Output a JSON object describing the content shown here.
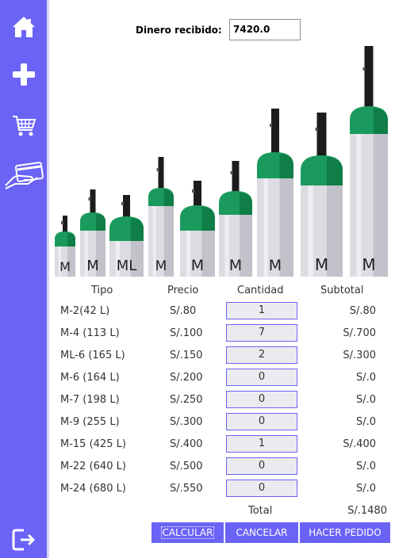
{
  "sidebar": {
    "items": [
      {
        "icon": "home-icon"
      },
      {
        "icon": "plus-icon"
      },
      {
        "icon": "cart-icon"
      },
      {
        "icon": "payment-card-icon"
      }
    ],
    "logout_icon": "logout-icon"
  },
  "received": {
    "label": "Dinero recibido:",
    "value": "7420.0"
  },
  "cylinders": [
    {
      "letter": "M"
    },
    {
      "letter": "M"
    },
    {
      "letter": "ML"
    },
    {
      "letter": "M"
    },
    {
      "letter": "M"
    },
    {
      "letter": "M"
    },
    {
      "letter": "M"
    },
    {
      "letter": "M"
    },
    {
      "letter": "M"
    }
  ],
  "table": {
    "headers": [
      "Tipo",
      "Precio",
      "Cantidad",
      "Subtotal"
    ],
    "rows": [
      {
        "tipo": "M-2(42 L)",
        "precio": "S/.80",
        "cantidad": "1",
        "subtotal": "S/.80"
      },
      {
        "tipo": "M-4 (113 L)",
        "precio": "S/.100",
        "cantidad": "7",
        "subtotal": "S/.700"
      },
      {
        "tipo": "ML-6 (165 L)",
        "precio": "S/.150",
        "cantidad": "2",
        "subtotal": "S/.300"
      },
      {
        "tipo": "M-6 (164 L)",
        "precio": "S/.200",
        "cantidad": "0",
        "subtotal": "S/.0"
      },
      {
        "tipo": "M-7 (198 L)",
        "precio": "S/.250",
        "cantidad": "0",
        "subtotal": "S/.0"
      },
      {
        "tipo": "M-9 (255 L)",
        "precio": "S/.300",
        "cantidad": "0",
        "subtotal": "S/.0"
      },
      {
        "tipo": "M-15 (425 L)",
        "precio": "S/.400",
        "cantidad": "1",
        "subtotal": "S/.400"
      },
      {
        "tipo": "M-22 (640 L)",
        "precio": "S/.500",
        "cantidad": "0",
        "subtotal": "S/.0"
      },
      {
        "tipo": "M-24 (680 L)",
        "precio": "S/.550",
        "cantidad": "0",
        "subtotal": "S/.0"
      }
    ],
    "total_label": "Total",
    "total_value": "S/.1480"
  },
  "buttons": {
    "calcular": "CALCULAR",
    "cancelar": "CANCELAR",
    "pedido": "HACER PEDIDO"
  },
  "colors": {
    "sidebar": "#6a63f6",
    "accent_green": "#1a9a5c",
    "cylinder_body": "#dcdce2"
  }
}
